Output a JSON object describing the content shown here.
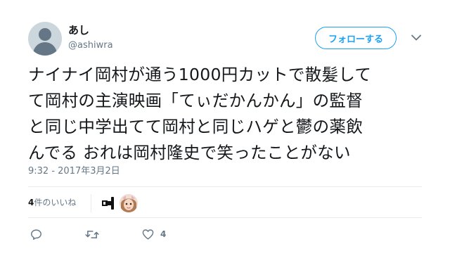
{
  "user": {
    "display_name": "あし",
    "handle": "@ashiwra"
  },
  "follow_button": {
    "label": "フォローする"
  },
  "tweet": {
    "lines": [
      "ナイナイ岡村が通う1000円カットで散髪して",
      "て岡村の主演映画「てぃだかんかん」の監督",
      "と同じ中学出てて岡村と同じハゲと鬱の薬飲",
      "んでる おれは岡村隆史で笑ったことがない"
    ],
    "timestamp": "9:32 - 2017年3月2日"
  },
  "stats": {
    "likes_number": "4",
    "likes_suffix": "件のいいね"
  },
  "actions": {
    "reply_count": "",
    "retweet_count": "",
    "like_count": "4"
  },
  "colors": {
    "accent": "#1da1f2",
    "text": "#14171a",
    "muted": "#657786",
    "border": "#e6ecf0"
  },
  "icons": {
    "reply": "reply-icon",
    "retweet": "retweet-icon",
    "like": "heart-icon",
    "caret": "chevron-down-icon"
  }
}
